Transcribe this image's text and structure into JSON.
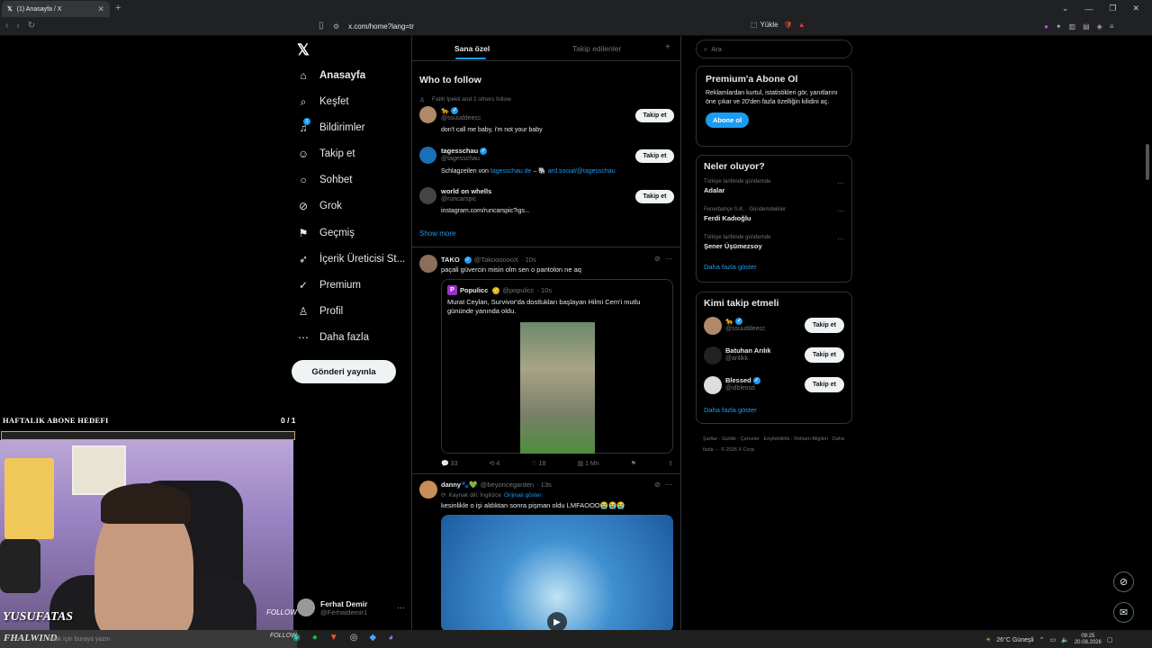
{
  "browser": {
    "tab_title": "(1) Anasayfa / X",
    "url": "x.com/home?lang=tr",
    "upload_label": "Yükle"
  },
  "nav": {
    "items": [
      {
        "label": "Anasayfa",
        "icon": "home-icon"
      },
      {
        "label": "Keşfet",
        "icon": "search-icon"
      },
      {
        "label": "Bildirimler",
        "icon": "bell-icon"
      },
      {
        "label": "Takip et",
        "icon": "add-user-icon"
      },
      {
        "label": "Sohbet",
        "icon": "chat-icon"
      },
      {
        "label": "Grok",
        "icon": "grok-icon"
      },
      {
        "label": "Geçmiş",
        "icon": "bookmark-icon"
      },
      {
        "label": "İçerik Üreticisi St...",
        "icon": "rocket-icon"
      },
      {
        "label": "Premium",
        "icon": "premium-icon"
      },
      {
        "label": "Profil",
        "icon": "person-icon"
      },
      {
        "label": "Daha fazla",
        "icon": "more-circle-icon"
      }
    ],
    "post_button": "Gönderi yayınla",
    "notification_count": "1"
  },
  "profile": {
    "name": "Ferhat Demir",
    "handle": "@Ferhatdemir1"
  },
  "overlay": {
    "goal_title": "HAFTALIK ABONE HEDEFI",
    "goal_count": "0 / 1",
    "streamer": "YUSUFATAS",
    "follow_tag": "FOLLOW",
    "strip_name": "FHALWIND",
    "strip_search": "mak için buraya yazın",
    "strip_follow": "FOLLOW"
  },
  "feed": {
    "tabs": [
      "Sana özel",
      "Takip edilenler"
    ],
    "who_to_follow_title": "Who to follow",
    "followed_by": "Fatih İpekli and 2 others follow",
    "suggestions": [
      {
        "name": "🐆",
        "handle": "@ssuuddeecc",
        "bio": "don't call me baby, i'm not your baby",
        "button": "Takip et"
      },
      {
        "name": "tagesschau",
        "handle": "@tagesschau",
        "bio_prefix": "Schlagzeilen von ",
        "bio_link1": "tagesschau.de",
        "bio_mid": " – 🐘 ",
        "bio_link2": "ard.social/@tagesschau",
        "button": "Takip et"
      },
      {
        "name": "world on whells",
        "handle": "@runcarspic",
        "bio_link": "instagram.com/runcarspic?igs...",
        "button": "Takip et"
      }
    ],
    "show_more": "Show more",
    "tweet1": {
      "name": "TAKO",
      "handle": "@TakooooooX",
      "time": "· 10s",
      "text": "paçali güvercin misin olm sen o pantolon ne aq",
      "quote_name": "Populicc",
      "quote_handle": "@populicc",
      "quote_time": "· 10s",
      "quote_text": "Murat Ceylan, Survivor'da dostlukları başlayan Hilmi Cem'i mutlu gününde yanında oldu.",
      "replies": "33",
      "reposts": "4",
      "likes": "18",
      "views": "1 Mn"
    },
    "tweet2": {
      "name": "danny🐾💚",
      "handle": "@beyoncegarden",
      "time": "· 13s",
      "translated_from": "Kaynak dili: İngilizce",
      "show_original": "Orijinali göster",
      "text": "kesinlikle o işi aldıktan sonra pişman oldu LMFAOOO😭😭😭"
    }
  },
  "right": {
    "search_placeholder": "Ara",
    "premium_title": "Premium'a Abone Ol",
    "premium_text": "Reklamlardan kurtul, istatistikleri gör, yanıtlarını öne çıkar ve 20'den fazla özelliğin kilidini aç.",
    "premium_button": "Abone ol",
    "trends_title": "Neler oluyor?",
    "trends": [
      {
        "context": "Türkiye tarihinde gündemde",
        "name": "Adalar"
      },
      {
        "context": "Fenerbahçe S.K. · Gündemdekiler",
        "name": "Ferdi Kadıoğlu"
      },
      {
        "context": "Türkiye tarihinde gündemde",
        "name": "Şener Üşümezsoy"
      }
    ],
    "trends_more": "Daha fazla göster",
    "wtf_title": "Kimi takip etmeli",
    "wtf": [
      {
        "name": "🐆",
        "handle": "@ssuuddeecc",
        "button": "Takip et"
      },
      {
        "name": "Batuhan Arılık",
        "handle": "@arilikk",
        "button": "Takip et"
      },
      {
        "name": "Blessed",
        "handle": "@idblessd",
        "button": "Takip et"
      }
    ],
    "wtf_more": "Daha fazla göster",
    "footer": "Şartlar  ·  Gizlilik  ·  Çerezler  ·  Erişilebilirlik  ·  Reklam Bilgileri  ·  Daha fazla ···  © 2026 X Corp."
  },
  "taskbar": {
    "weather": "26°C  Güneşli",
    "time": "09:25",
    "date": "20.08.2026"
  },
  "colors": {
    "accent": "#1d9bf0",
    "background": "#000000",
    "border": "#2f3336",
    "muted": "#71767b"
  }
}
